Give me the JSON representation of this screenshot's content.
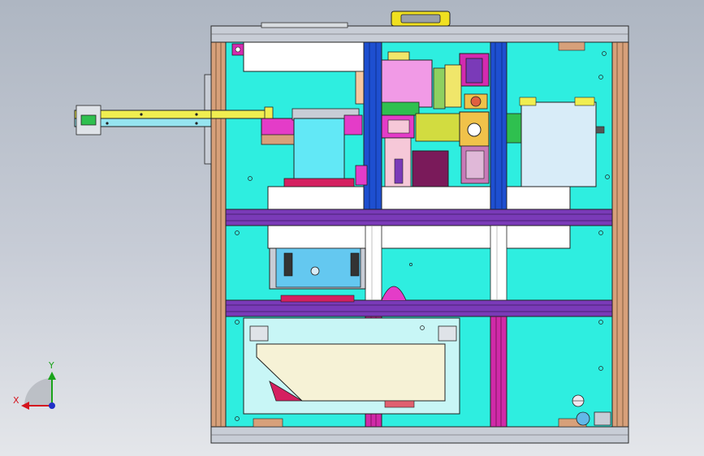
{
  "triad": {
    "x_label": "X",
    "y_label": "Y",
    "x_color": "#d4141e",
    "y_color": "#1aa31a",
    "z_color": "#2030c8"
  },
  "colors": {
    "background_top": "#aeb6c2",
    "background_bottom": "#e4e6ea",
    "panel_fill": "#2eeee0",
    "frame_orange": "#d7a07a",
    "frame_grey": "#c8cdd6",
    "rail_blue": "#1e4fd0",
    "rail_magenta": "#d02aa8",
    "purple_bar": "#7a3ab8",
    "yellow_slide": "#f0ee50",
    "magenta_block": "#e43cc8",
    "handle_yellow": "#f0e020",
    "cream_plate": "#f6f2d6"
  }
}
